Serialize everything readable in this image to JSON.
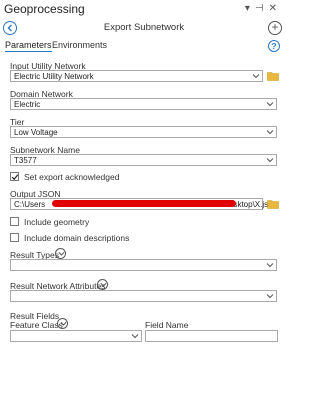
{
  "app_title": "Geoprocessing",
  "window_controls": [
    "▾",
    "⊣",
    "✕"
  ],
  "tool_title": "Export Subnetwork",
  "tabs": [
    "Parameters",
    "Environments"
  ],
  "input_utility_network": {
    "label": "Input Utility Network",
    "value": "Electric Utility Network"
  },
  "domain_network": {
    "label": "Domain Network",
    "value": "Electric"
  },
  "tier": {
    "label": "Tier",
    "value": "Low Voltage"
  },
  "subnetwork_name": {
    "label": "Subnetwork Name",
    "value": "T3577"
  },
  "set_export_acknowledged": {
    "label": "Set export acknowledged",
    "checked": true
  },
  "output_json": {
    "label": "Output JSON",
    "value_start": "C:\\Users",
    "value_end": "esktop\\X.json"
  },
  "include_geometry": {
    "label": "Include geometry",
    "checked": false
  },
  "include_domain_descriptions": {
    "label": "Include domain descriptions",
    "checked": false
  },
  "result_types": {
    "label": "Result Types",
    "value": ""
  },
  "result_network_attributes": {
    "label": "Result Network Attributes",
    "value": ""
  },
  "result_fields": {
    "label": "Result Fields",
    "feature_class_label": "Feature Class",
    "field_name_label": "Field Name",
    "feature_class_value": "",
    "field_name_value": ""
  },
  "colors": {
    "accent": "#2b78c5",
    "folder": "#e8b83d",
    "redaction": "#e00000"
  }
}
